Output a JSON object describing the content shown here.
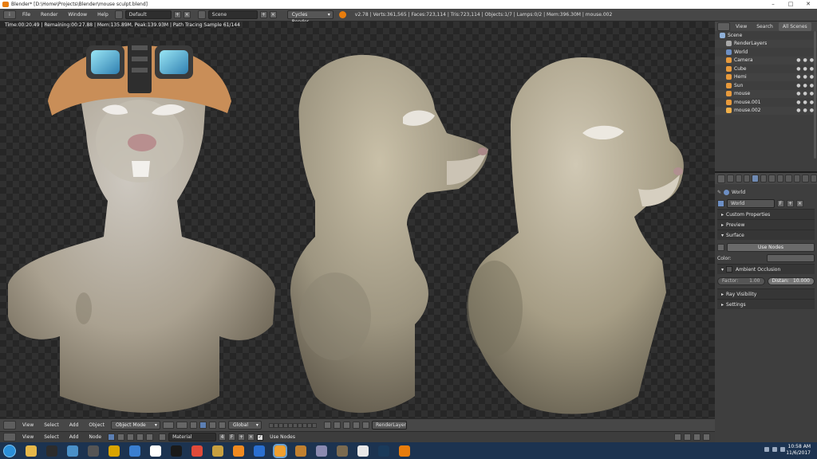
{
  "window": {
    "title": "Blender* [D:\\Home\\Projects\\Blender\\mouse sculpt.blend]",
    "controls": [
      "–",
      "□",
      "✕"
    ]
  },
  "infobar": {
    "menus": [
      "File",
      "Render",
      "Window",
      "Help"
    ],
    "screen_layout": "Default",
    "scene": "Scene",
    "engine": "Cycles Render",
    "stats": "v2.78 | Verts:361,565 | Faces:723,114 | Tris:723,114 | Objects:1/7 | Lamps:0/2 | Mem:396.30M | mouse.002"
  },
  "viewport": {
    "render_status": "Time:00:20.49 | Remaining:00:27.88 | Mem:135.89M, Peak:139.93M | Path Tracing Sample 61/144",
    "colors": {
      "skin": "#b2a88f",
      "goggle_band": "#c98e58",
      "lens": "#4fb8d9",
      "muzzle": "#c9c0ae"
    }
  },
  "view3d_header": {
    "menus": [
      "View",
      "Select",
      "Add",
      "Object"
    ],
    "mode": "Object Mode",
    "orientation": "Global",
    "render_layer": "RenderLayer"
  },
  "node_header": {
    "menus": [
      "View",
      "Select",
      "Add",
      "Node"
    ],
    "material": "Material",
    "users": "4",
    "fake_user": "F",
    "use_nodes_label": "Use Nodes"
  },
  "outliner": {
    "tabs": [
      "View",
      "Search",
      "All Scenes"
    ],
    "items": [
      {
        "name": "Scene",
        "icon": "scene-icon",
        "color": "#8fb0d8"
      },
      {
        "name": "RenderLayers",
        "icon": "renderlayers-icon",
        "color": "#a9a9a9"
      },
      {
        "name": "World",
        "icon": "world-icon",
        "color": "#6d8fc4"
      },
      {
        "name": "Camera",
        "icon": "camera-icon",
        "color": "#e89a3c"
      },
      {
        "name": "Cube",
        "icon": "mesh-icon",
        "color": "#e89a3c"
      },
      {
        "name": "Hemi",
        "icon": "lamp-icon",
        "color": "#e89a3c"
      },
      {
        "name": "Sun",
        "icon": "lamp-icon",
        "color": "#e89a3c"
      },
      {
        "name": "mouse",
        "icon": "mesh-icon",
        "color": "#e89a3c"
      },
      {
        "name": "mouse.001",
        "icon": "mesh-icon",
        "color": "#e89a3c"
      },
      {
        "name": "mouse.002",
        "icon": "mesh-icon",
        "color": "#f0b04a"
      }
    ]
  },
  "properties": {
    "context": "World",
    "world_field": "World",
    "world_users": "F",
    "panels": {
      "custom_properties": "Custom Properties",
      "preview": "Preview",
      "surface": "Surface",
      "use_nodes": "Use Nodes",
      "color_label": "Color:",
      "ambient_occlusion": "Ambient Occlusion",
      "factor_label": "Factor:",
      "factor_value": "1.00",
      "distance_label": "Distan:",
      "distance_value": "10.000",
      "ray_visibility": "Ray Visibility",
      "settings": "Settings"
    }
  },
  "taskbar": {
    "time": "10:58 AM",
    "date": "11/6/2017",
    "icons": [
      {
        "name": "explorer-icon",
        "color": "#e6b84a"
      },
      {
        "name": "media-icon",
        "color": "#2c2c2c"
      },
      {
        "name": "recycle-icon",
        "color": "#4a90c8"
      },
      {
        "name": "zbrush-icon",
        "color": "#555555"
      },
      {
        "name": "headphones-icon",
        "color": "#d9a400"
      },
      {
        "name": "folder-icon",
        "color": "#3a7fd0"
      },
      {
        "name": "7zip-icon",
        "color": "#ffffff"
      },
      {
        "name": "pen-icon",
        "color": "#1a1a1a"
      },
      {
        "name": "chrome-icon",
        "color": "#e04a3a"
      },
      {
        "name": "lion-icon",
        "color": "#c8a040"
      },
      {
        "name": "firefox-icon",
        "color": "#f08a20"
      },
      {
        "name": "daz-icon",
        "color": "#2a6fd0"
      },
      {
        "name": "player-icon",
        "color": "#f0a030"
      },
      {
        "name": "badge-icon",
        "color": "#c08030"
      },
      {
        "name": "box-icon",
        "color": "#8a8ab0"
      },
      {
        "name": "gimp-icon",
        "color": "#7a6a50"
      },
      {
        "name": "inkscape-icon",
        "color": "#e8e8e8"
      },
      {
        "name": "steam-icon",
        "color": "#1a3a5a"
      },
      {
        "name": "blender-icon",
        "color": "#e87d0d"
      }
    ]
  }
}
